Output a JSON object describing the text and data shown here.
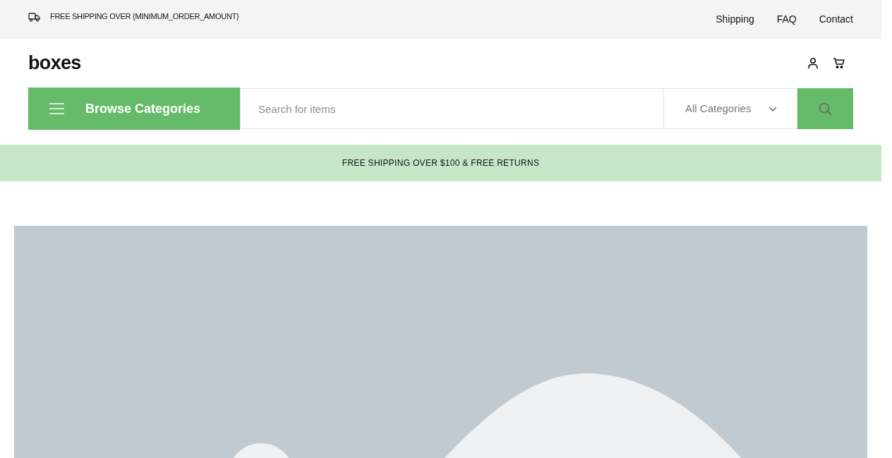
{
  "top_bar": {
    "shipping_notice": "FREE SHIPPING OVER {MINIMUM_ORDER_AMOUNT}",
    "links": [
      "Shipping",
      "FAQ",
      "Contact"
    ]
  },
  "header": {
    "logo": "boxes"
  },
  "nav": {
    "browse_button": "Browse Categories",
    "search": {
      "placeholder": "Search for items"
    },
    "category_select": "All Categories"
  },
  "promo_banner": "FREE SHIPPING OVER $100 & FREE RETURNS"
}
